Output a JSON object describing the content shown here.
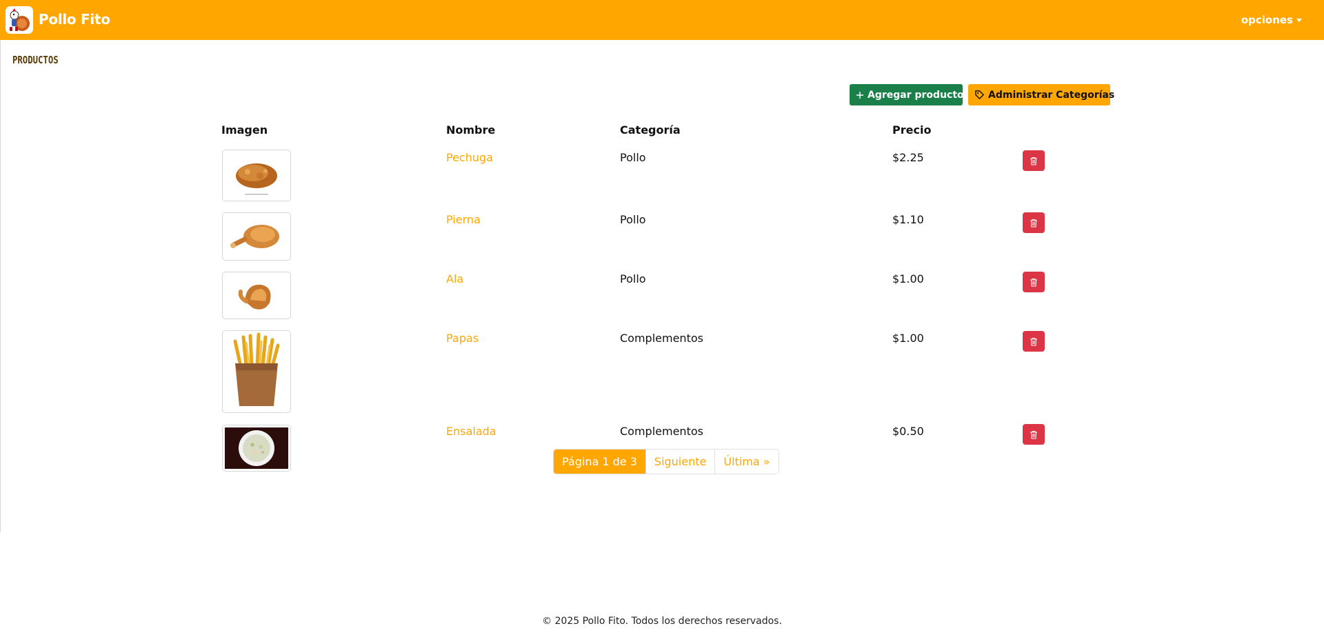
{
  "header": {
    "brand": "Pollo Fito",
    "logo_icon": "chicken-mascot-icon",
    "options_label": "opciones",
    "background": "#ffa600"
  },
  "page": {
    "title": "PRODUCTOS"
  },
  "actions": {
    "add_label": "Agregar producto",
    "categories_label": "Administrar Categorías"
  },
  "table": {
    "headers": [
      "Imagen",
      "Nombre",
      "Categoría",
      "Precio"
    ],
    "rows": [
      {
        "name": "Pechuga",
        "category": "Pollo",
        "price": "$2.25",
        "image_icon": "fried-chicken-breast"
      },
      {
        "name": "Pierna",
        "category": "Pollo",
        "price": "$1.10",
        "image_icon": "fried-chicken-leg"
      },
      {
        "name": "Ala",
        "category": "Pollo",
        "price": "$1.00",
        "image_icon": "fried-chicken-wing"
      },
      {
        "name": "Papas",
        "category": "Complementos",
        "price": "$1.00",
        "image_icon": "french-fries"
      },
      {
        "name": "Ensalada",
        "category": "Complementos",
        "price": "$0.50",
        "image_icon": "coleslaw-salad"
      }
    ]
  },
  "pagination": {
    "current": "Página 1 de 3",
    "next": "Siguiente",
    "last": "Última »"
  },
  "footer": {
    "text": "© 2025 Pollo Fito. Todos los derechos reservados."
  },
  "colors": {
    "accent": "#ffa600",
    "add_button": "#1b7f4a",
    "delete_button": "#dc3545"
  }
}
